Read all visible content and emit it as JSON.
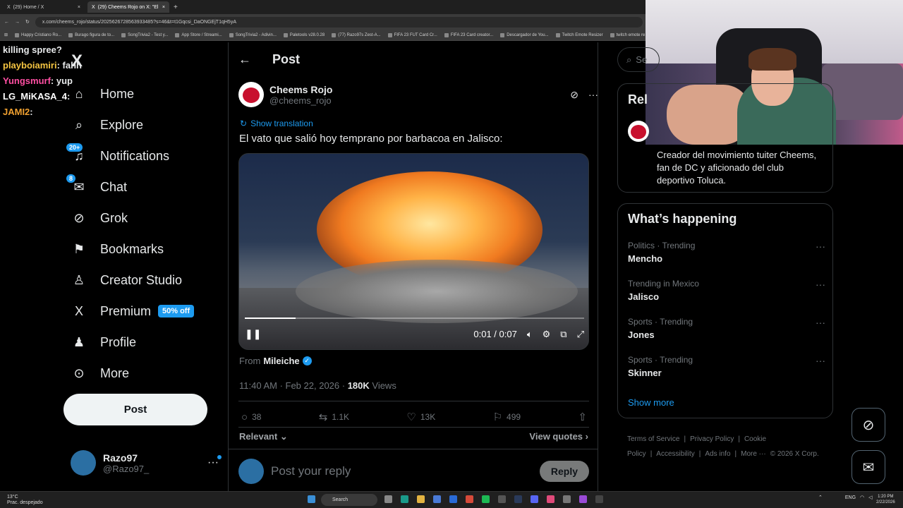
{
  "browser": {
    "tabs": [
      {
        "label": "(29) Home / X",
        "active": false
      },
      {
        "label": "(29) Cheems Rojo on X: \"El",
        "active": true
      }
    ],
    "url": "x.com/cheems_rojo/status/2025626728563933485?s=46&t=t1Gqcsi_DaONGEjT1qH5yA",
    "bookmarks": [
      "Happy Cristiano Ro...",
      "Burago figura de to...",
      "SongTrivia2 - Test y...",
      "App Store / Streami...",
      "SongTrivia2 - Adivin...",
      "Paletools v28.0.28",
      "(77) Razo97s Zest-A...",
      "FIFA 23 FUT Card Cr...",
      "FIFA 23 Card creator...",
      "Descargador de You...",
      "Twitch Emote Resizer",
      "twitch emote re"
    ]
  },
  "chat": {
    "messages": [
      {
        "user": "",
        "text": "killing spree?",
        "color": "#ffffff"
      },
      {
        "user": "playboiamiri",
        "text": ": fahh",
        "color": "#f5c542"
      },
      {
        "user": "Yungsmurf",
        "text": ": yup",
        "color": "#ff4fa3"
      },
      {
        "user": "LG_MiKASA_4",
        "text": ":",
        "color": "#ffffff"
      },
      {
        "user": "JAMI2",
        "text": ":",
        "color": "#f0a030"
      }
    ]
  },
  "nav": {
    "logo": "X",
    "items": [
      {
        "label": "Home",
        "icon": "home-icon",
        "glyph": "⌂",
        "badge": ""
      },
      {
        "label": "Explore",
        "icon": "search-icon",
        "glyph": "⌕",
        "badge": ""
      },
      {
        "label": "Notifications",
        "icon": "bell-icon",
        "glyph": "♫",
        "badge": "20+"
      },
      {
        "label": "Chat",
        "icon": "mail-icon",
        "glyph": "✉",
        "badge": "8"
      },
      {
        "label": "Grok",
        "icon": "grok-icon",
        "glyph": "⊘",
        "badge": ""
      },
      {
        "label": "Bookmarks",
        "icon": "bookmark-icon",
        "glyph": "⚑",
        "badge": ""
      },
      {
        "label": "Creator Studio",
        "icon": "creator-icon",
        "glyph": "♙",
        "badge": ""
      },
      {
        "label": "Premium",
        "icon": "x-icon",
        "glyph": "X",
        "badge": ""
      },
      {
        "label": "Profile",
        "icon": "person-icon",
        "glyph": "♟",
        "badge": ""
      },
      {
        "label": "More",
        "icon": "more-circle-icon",
        "glyph": "⊙",
        "badge": ""
      }
    ],
    "premium_promo": "50% off",
    "post_button": "Post",
    "account": {
      "name": "Razo97",
      "handle": "@Razo97_",
      "more": "···"
    }
  },
  "post": {
    "header_title": "Post",
    "author_name": "Cheems Rojo",
    "author_handle": "@cheems_rojo",
    "show_translation": "Show translation",
    "text": "El vato que salió hoy temprano por barbacoa en Jalisco:",
    "video": {
      "time": "0:01 / 0:07",
      "progress": 0.15
    },
    "from_label": "From",
    "from_user": "Mileiche",
    "timestamp": "11:40 AM · Feb 22, 2026 · ",
    "views_count": "180K",
    "views_label": " Views",
    "replies": "38",
    "reposts": "1.1K",
    "likes": "13K",
    "bookmarks": "499",
    "sort_label": "Relevant",
    "view_quotes": "View quotes",
    "reply_placeholder": "Post your reply",
    "reply_button": "Reply"
  },
  "right": {
    "search_placeholder": "Se",
    "relevant_title": "Rel",
    "bio": "Creador del movimiento tuiter Cheems, fan de DC y aficionado del club deportivo Toluca.",
    "happening_title": "What’s happening",
    "trends": [
      {
        "context": "Politics · Trending",
        "name": "Mencho"
      },
      {
        "context": "Trending in Mexico",
        "name": "Jalisco"
      },
      {
        "context": "Sports · Trending",
        "name": "Jones"
      },
      {
        "context": "Sports · Trending",
        "name": "Skinner"
      }
    ],
    "show_more": "Show more",
    "footer": [
      "Terms of Service",
      "|",
      "Privacy Policy",
      "|",
      "Cookie Policy",
      "|",
      "Accessibility",
      "|",
      "Ads info",
      "|",
      "More ···",
      "© 2026 X Corp."
    ]
  },
  "taskbar": {
    "temp": "13°C",
    "weather": "Prac. despejado",
    "search": "Search",
    "lang": "ENG",
    "time": "1:20 PM",
    "date": "2/22/2026"
  }
}
